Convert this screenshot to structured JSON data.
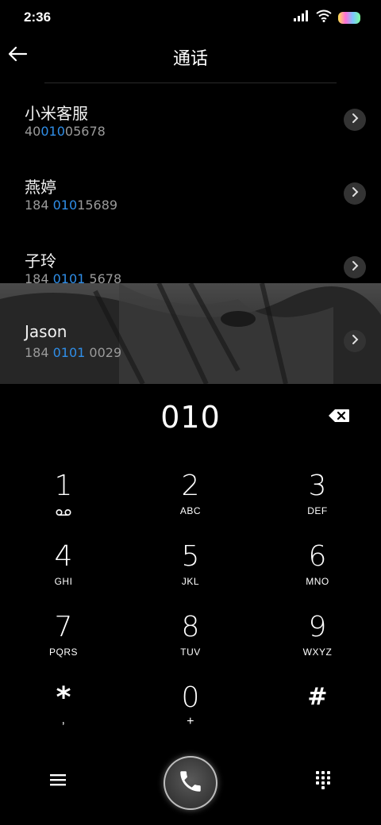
{
  "status_bar": {
    "time": "2:36"
  },
  "header": {
    "title": "通话"
  },
  "results": [
    {
      "name": "小米客服",
      "number_pre": "40",
      "number_match": "010",
      "number_post": "05678"
    },
    {
      "name": "燕婷",
      "number_pre": "184 ",
      "number_match": "010",
      "number_post": "15689"
    },
    {
      "name": "子玲",
      "number_pre": "184 ",
      "number_match": "0101",
      "number_post": " 5678"
    },
    {
      "name": "Jason",
      "number_pre": "184 ",
      "number_match": "0101",
      "number_post": " 0029"
    }
  ],
  "dial": {
    "number": "010"
  },
  "keypad": {
    "keys": [
      {
        "digit": "1",
        "sub": ""
      },
      {
        "digit": "2",
        "sub": "ABC"
      },
      {
        "digit": "3",
        "sub": "DEF"
      },
      {
        "digit": "4",
        "sub": "GHI"
      },
      {
        "digit": "5",
        "sub": "JKL"
      },
      {
        "digit": "6",
        "sub": "MNO"
      },
      {
        "digit": "7",
        "sub": "PQRS"
      },
      {
        "digit": "8",
        "sub": "TUV"
      },
      {
        "digit": "9",
        "sub": "WXYZ"
      },
      {
        "digit": "*",
        "sub": ","
      },
      {
        "digit": "0",
        "sub": "+"
      },
      {
        "digit": "#",
        "sub": ""
      }
    ]
  },
  "icons": {
    "back": "arrow-left-icon",
    "chevron": "chevron-right-icon",
    "backspace": "backspace-icon",
    "voicemail": "voicemail-icon",
    "menu": "menu-icon",
    "call": "phone-icon",
    "dialpad": "dialpad-icon"
  },
  "colors": {
    "match_highlight": "#2f8ee8",
    "background": "#000000"
  }
}
